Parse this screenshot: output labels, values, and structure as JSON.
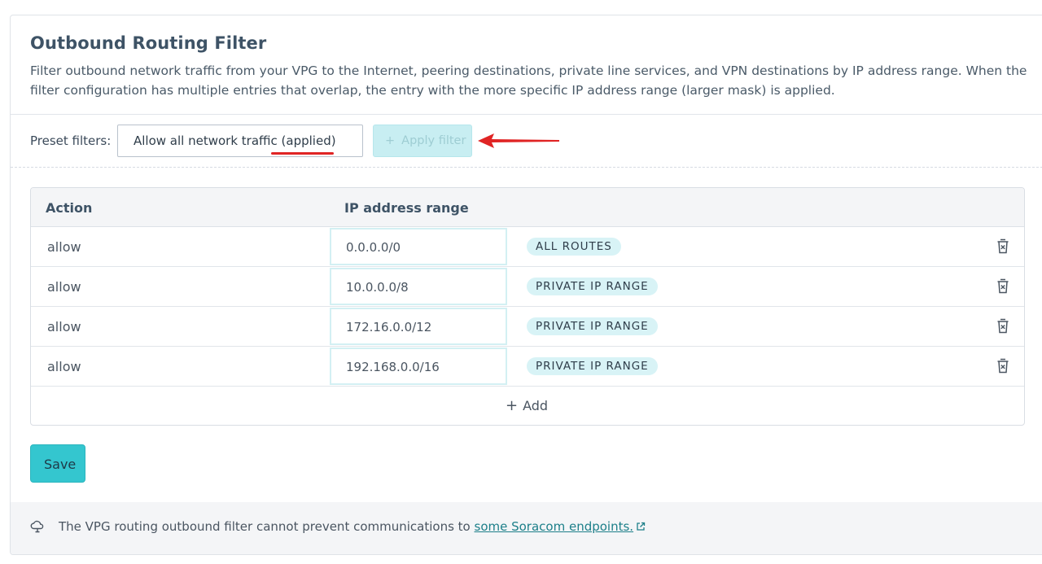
{
  "section": {
    "title": "Outbound Routing Filter",
    "description": "Filter outbound network traffic from your VPG to the Internet, peering destinations, private line services, and VPN destinations by IP address range. When the filter configuration has multiple entries that overlap, the entry with the more specific IP address range (larger mask) is applied."
  },
  "preset": {
    "label": "Preset filters:",
    "selected_prefix": "Allow all network traffic ",
    "selected_suffix": "(applied)",
    "apply_plus": "+",
    "apply_label": "Apply filter"
  },
  "table": {
    "headers": {
      "action": "Action",
      "ip_range": "IP address range"
    },
    "rows": [
      {
        "action": "allow",
        "ip": "0.0.0.0/0",
        "badge": "ALL ROUTES"
      },
      {
        "action": "allow",
        "ip": "10.0.0.0/8",
        "badge": "PRIVATE IP RANGE"
      },
      {
        "action": "allow",
        "ip": "172.16.0.0/12",
        "badge": "PRIVATE IP RANGE"
      },
      {
        "action": "allow",
        "ip": "192.168.0.0/16",
        "badge": "PRIVATE IP RANGE"
      }
    ],
    "add_plus": "+",
    "add_label": "Add"
  },
  "save_label": "Save",
  "footer": {
    "text": "The VPG routing outbound filter cannot prevent communications to ",
    "link_text": "some Soracom endpoints."
  },
  "icons": {
    "apply_arrow": "red-arrow-icon",
    "delete": "trash-icon",
    "footer": "cloud-icon",
    "external": "external-link-icon"
  },
  "colors": {
    "accent": "#34c6cf",
    "badge_bg": "#d8f3f6",
    "annotation": "#e02424",
    "link": "#1c7f89"
  }
}
